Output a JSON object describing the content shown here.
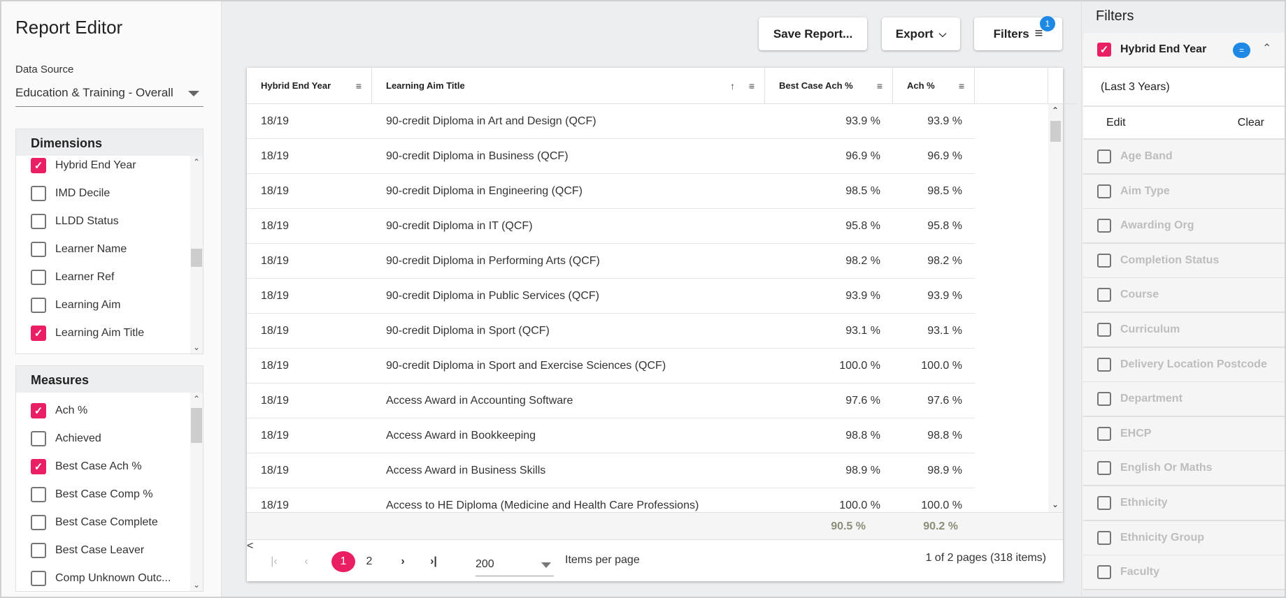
{
  "left": {
    "title": "Report Editor",
    "data_source_label": "Data Source",
    "data_source_value": "Education & Training - Overall",
    "dimensions": {
      "header": "Dimensions",
      "items": [
        {
          "label": "Hybrid End Year",
          "checked": true
        },
        {
          "label": "IMD Decile",
          "checked": false
        },
        {
          "label": "LLDD Status",
          "checked": false
        },
        {
          "label": "Learner Name",
          "checked": false
        },
        {
          "label": "Learner Ref",
          "checked": false
        },
        {
          "label": "Learning Aim",
          "checked": false
        },
        {
          "label": "Learning Aim Title",
          "checked": true
        }
      ]
    },
    "measures": {
      "header": "Measures",
      "items": [
        {
          "label": "Ach %",
          "checked": true
        },
        {
          "label": "Achieved",
          "checked": false
        },
        {
          "label": "Best Case Ach %",
          "checked": true
        },
        {
          "label": "Best Case Comp %",
          "checked": false
        },
        {
          "label": "Best Case Complete",
          "checked": false
        },
        {
          "label": "Best Case Leaver",
          "checked": false
        },
        {
          "label": "Comp Unknown Outc...",
          "checked": false
        }
      ]
    }
  },
  "toolbar": {
    "save_label": "Save Report...",
    "export_label": "Export",
    "filters_label": "Filters",
    "filters_badge": "1"
  },
  "table": {
    "columns": [
      "Hybrid End Year",
      "Learning Aim Title",
      "Best Case Ach %",
      "Ach %"
    ],
    "sort": {
      "column": "Learning Aim Title",
      "direction": "ascending"
    },
    "rows": [
      [
        "18/19",
        "90-credit Diploma in Art and Design (QCF)",
        "93.9 %",
        "93.9 %"
      ],
      [
        "18/19",
        "90-credit Diploma in Business (QCF)",
        "96.9 %",
        "96.9 %"
      ],
      [
        "18/19",
        "90-credit Diploma in Engineering (QCF)",
        "98.5 %",
        "98.5 %"
      ],
      [
        "18/19",
        "90-credit Diploma in IT (QCF)",
        "95.8 %",
        "95.8 %"
      ],
      [
        "18/19",
        "90-credit Diploma in Performing Arts (QCF)",
        "98.2 %",
        "98.2 %"
      ],
      [
        "18/19",
        "90-credit Diploma in Public Services (QCF)",
        "93.9 %",
        "93.9 %"
      ],
      [
        "18/19",
        "90-credit Diploma in Sport (QCF)",
        "93.1 %",
        "93.1 %"
      ],
      [
        "18/19",
        "90-credit Diploma in Sport and Exercise Sciences (QCF)",
        "100.0 %",
        "100.0 %"
      ],
      [
        "18/19",
        "Access Award in Accounting Software",
        "97.6 %",
        "97.6 %"
      ],
      [
        "18/19",
        "Access Award in Bookkeeping",
        "98.8 %",
        "98.8 %"
      ],
      [
        "18/19",
        "Access Award in Business Skills",
        "98.9 %",
        "98.9 %"
      ],
      [
        "18/19",
        "Access to HE Diploma (Medicine and Health Care Professions)",
        "100.0 %",
        "100.0 %"
      ]
    ],
    "totals": {
      "best_case": "90.5 %",
      "ach": "90.2 %"
    }
  },
  "pager": {
    "pages": [
      "1",
      "2"
    ],
    "current": "1",
    "page_size": "200",
    "page_size_label": "Items per page",
    "summary": "1 of 2 pages (318 items)"
  },
  "filters": {
    "header": "Filters",
    "active": {
      "label": "Hybrid End Year",
      "operator": "=",
      "value": "(Last 3 Years)",
      "edit": "Edit",
      "clear": "Clear"
    },
    "items": [
      "Age Band",
      "Aim Type",
      "Awarding Org",
      "Completion Status",
      "Course",
      "Curriculum",
      "Delivery Location Postcode",
      "Department",
      "EHCP",
      "English Or Maths",
      "Ethnicity",
      "Ethnicity Group",
      "Faculty"
    ]
  },
  "colors": {
    "accent": "#e91e63",
    "badge": "#1e88e5"
  }
}
